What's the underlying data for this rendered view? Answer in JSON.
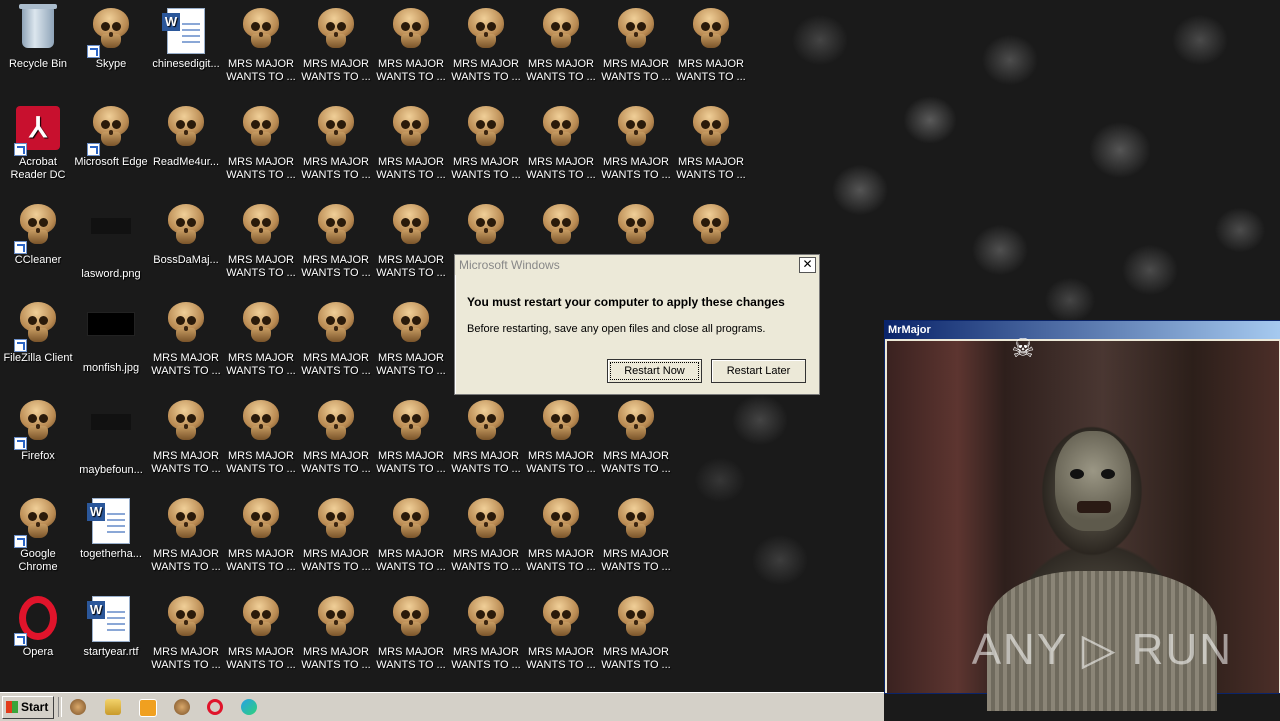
{
  "desktop": {
    "icons": [
      {
        "label": "Recycle Bin"
      },
      {
        "label": "Acrobat Reader DC"
      },
      {
        "label": "CCleaner"
      },
      {
        "label": "FileZilla Client"
      },
      {
        "label": "Firefox"
      },
      {
        "label": "Google Chrome"
      },
      {
        "label": "Opera"
      },
      {
        "label": "Skype"
      },
      {
        "label": "Microsoft Edge"
      },
      {
        "label": "lasword.png"
      },
      {
        "label": "monfish.jpg"
      },
      {
        "label": "maybefoun..."
      },
      {
        "label": "togetherha..."
      },
      {
        "label": "startyear.rtf"
      },
      {
        "label": "chinesedigit..."
      },
      {
        "label": "ReadMe4ur..."
      },
      {
        "label": "BossDaMaj..."
      }
    ],
    "mrs_major_label": "MRS MAJOR WANTS TO ..."
  },
  "dialog": {
    "title": "Microsoft Windows",
    "heading": "You must restart your computer to apply these changes",
    "message": "Before restarting, save any open files and close all programs.",
    "restart_now": "Restart Now",
    "restart_later": "Restart Later",
    "close": "✕"
  },
  "mrmajor_window": {
    "title": "MrMajor",
    "watermark": "ANY ▷ RUN"
  },
  "taskbar": {
    "start_label": "Start"
  }
}
